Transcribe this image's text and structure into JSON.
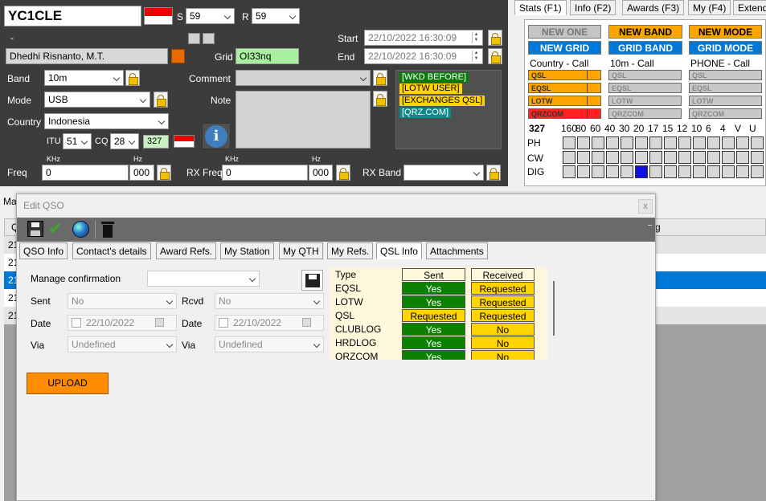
{
  "callsign": "YC1CLE",
  "rst": {
    "s_label": "S",
    "s_value": "59",
    "r_label": "R",
    "r_value": "59"
  },
  "dash": "-",
  "name": "Dhedhi Risnanto, M.T.",
  "grid": {
    "label": "Grid",
    "value": "OI33nq"
  },
  "start": {
    "label": "Start",
    "value": "22/10/2022 16:30:09"
  },
  "end": {
    "label": "End",
    "value": "22/10/2022 16:30:09"
  },
  "band": {
    "label": "Band",
    "value": "10m"
  },
  "mode": {
    "label": "Mode",
    "value": "USB"
  },
  "country": {
    "label": "Country",
    "value": "Indonesia"
  },
  "itu": {
    "label": "ITU",
    "value": "51"
  },
  "cq": {
    "label": "CQ",
    "value": "28"
  },
  "dxcc_num": "327",
  "comment_label": "Comment",
  "note_label": "Note",
  "tags": [
    "[WKD BEFORE]",
    "[LOTW USER]",
    "[EXCHANGES QSL]",
    "[QRZ.COM]"
  ],
  "freq": {
    "label": "Freq",
    "khz": "KHz",
    "hz": "Hz",
    "value": "0",
    "hz_value": "000"
  },
  "rxfreq": {
    "label": "RX Freq",
    "khz": "KHz",
    "hz": "Hz",
    "value": "0",
    "hz_value": "000"
  },
  "rxband_label": "RX Band",
  "stats_tabs": [
    "Stats (F1)",
    "Info (F2)",
    "Awards (F3)",
    "My (F4)",
    "Extend"
  ],
  "status_buttons": [
    [
      "NEW ONE",
      "NEW BAND",
      "NEW MODE"
    ],
    [
      "NEW GRID",
      "GRID BAND",
      "GRID MODE"
    ]
  ],
  "stats_columns": [
    "Country - Call",
    "10m - Call",
    "PHONE - Call"
  ],
  "stat_items": [
    "QSL",
    "EQSL",
    "LOTW",
    "QRZCOM"
  ],
  "band_header": {
    "num": "327",
    "bands": [
      "160",
      "80",
      "60",
      "40",
      "30",
      "20",
      "17",
      "15",
      "12",
      "10",
      "6",
      "4",
      "V",
      "U"
    ]
  },
  "band_rows": [
    "PH",
    "CW",
    "DIG"
  ],
  "behind": {
    "tab_label": "Ma",
    "col_label": "Q",
    "right_col": "g",
    "rows": [
      "21",
      "21",
      "21",
      "21",
      "21"
    ]
  },
  "dialog": {
    "title": "Edit QSO",
    "close": "x",
    "tabs": [
      "QSO Info",
      "Contact's details",
      "Award Refs.",
      "My Station",
      "My QTH",
      "My Refs.",
      "QSL Info",
      "Attachments"
    ],
    "manage_label": "Manage confirmation",
    "sent_label": "Sent",
    "sent_value": "No",
    "rcvd_label": "Rcvd",
    "rcvd_value": "No",
    "date_label": "Date",
    "date_sent": "22/10/2022",
    "date_rcvd": "22/10/2022",
    "via_label": "Via",
    "via_sent": "Undefined",
    "via_rcvd": "Undefined",
    "upload": "UPLOAD",
    "qsl_table": {
      "headers": [
        "Type",
        "Sent",
        "Received"
      ],
      "rows": [
        [
          "EQSL",
          "Yes",
          "Requested"
        ],
        [
          "LOTW",
          "Yes",
          "Requested"
        ],
        [
          "QSL",
          "Requested",
          "Requested"
        ],
        [
          "CLUBLOG",
          "Yes",
          "No"
        ],
        [
          "HRDLOG",
          "Yes",
          "No"
        ],
        [
          "QRZCOM",
          "Yes",
          "No"
        ]
      ]
    }
  },
  "colors": {
    "yes": "#0c8000",
    "pending": "#ffd400",
    "accent": "#0078d7"
  }
}
